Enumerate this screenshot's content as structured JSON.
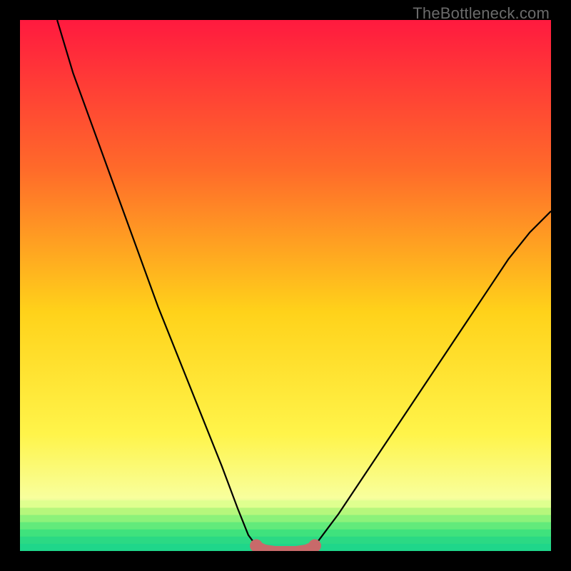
{
  "watermark": "TheBottleneck.com",
  "colors": {
    "bg_top": "#ff1a3f",
    "bg_mid1": "#ff6a2a",
    "bg_mid2": "#ffd21a",
    "bg_low1": "#fff44a",
    "bg_low2": "#f8ff9d",
    "bg_green1": "#8cf27a",
    "bg_green2": "#36e07d",
    "bg_green3": "#1fd68a",
    "curve": "#000000",
    "marker": "#c86a6a"
  },
  "chart_data": {
    "type": "line",
    "title": "",
    "xlabel": "",
    "ylabel": "",
    "xlim": [
      0,
      100
    ],
    "ylim": [
      0,
      100
    ],
    "grid": false,
    "legend": false,
    "annotations": [
      "TheBottleneck.com"
    ],
    "series": [
      {
        "name": "left-branch",
        "x": [
          7,
          10,
          14,
          18,
          22,
          26,
          30,
          34,
          38,
          41,
          43,
          44.5
        ],
        "y": [
          100,
          90,
          79,
          68,
          57,
          46,
          36,
          26,
          16,
          8,
          3,
          1
        ]
      },
      {
        "name": "right-branch",
        "x": [
          55.5,
          57,
          60,
          64,
          68,
          72,
          76,
          80,
          84,
          88,
          92,
          96,
          100
        ],
        "y": [
          1,
          3,
          7,
          13,
          19,
          25,
          31,
          37,
          43,
          49,
          55,
          60,
          64
        ]
      },
      {
        "name": "trough-markers",
        "x": [
          44.5,
          46,
          48,
          50,
          52,
          54,
          55.5
        ],
        "y": [
          1,
          0.3,
          0,
          0,
          0,
          0.3,
          1
        ]
      }
    ]
  }
}
